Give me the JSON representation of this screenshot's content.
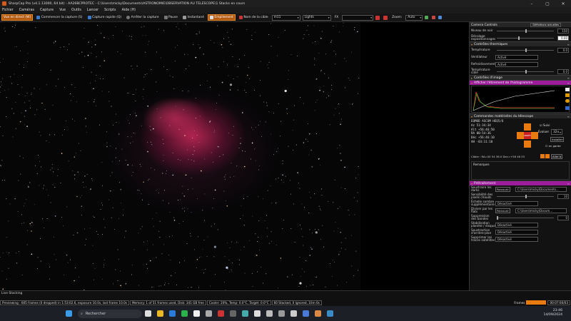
{
  "window": {
    "title": "SharpCap Pro (v4.1.13000, 64 bit) - AA26BCPROTEC - C:\\Users\\micky\\Documents\\ASTRONOMIE\\OBSERVATION AU TELESCOPE\\1 Stacks en cours"
  },
  "menu": [
    "Fichier",
    "Caméras",
    "Capture",
    "Vue",
    "Outils",
    "Lancer",
    "Scripts",
    "Aide (H)"
  ],
  "toolbar": {
    "live_view": "Vue en direct (W)",
    "start_capture": "Commencer la capture (S)",
    "quick_capture": "Capture rapide (Q)",
    "stop_capture": "Arrêter la capture",
    "pause": "Pause",
    "snapshot": "Instantané",
    "stack": "Empilement",
    "target_label": "Nom de la cible",
    "target_value": "m11",
    "frame_type": "Lights",
    "fx_label": "FX",
    "fx_value": "",
    "zoom_label": "Zoom:",
    "zoom_value": "Auto"
  },
  "panel": {
    "camera_controls": "Camera Controls",
    "camera_controls_button": "Définitions actuelles",
    "noise_label": "Niveau de noir",
    "noise_value": "150",
    "sep_label": "Décalage expositionnages",
    "sep_value": "0.00",
    "thermal_title": "Contrôles thermiques",
    "temperature_label": "Température",
    "temperature_value": "0.0",
    "fan_label": "Ventilateur",
    "fan_value": "Activé",
    "cooling_label": "Refroidissement",
    "cooling_value": "Activé",
    "target_temp_label": "Température cible",
    "target_temp_value": "0.0",
    "image_title": "Contrôles d'image",
    "histogram_title": "Afficher l'étirement de l'histogramme",
    "telescope_title": "Commandes matérielles du télescope",
    "mount_name": "EQMOD ASCOM HEQ5/6",
    "tele_lines": [
      "Az     51:34:34",
      "Alt   +56:46:50",
      "RA     00:54:36",
      "Déc   +56:46:10",
      "AH    -03:11:10"
    ],
    "tracking_label": "Suivi",
    "evaluate_label": "Évaluer",
    "speed_value": "32x",
    "install_label": "Installer",
    "park_label": "en garde",
    "goto_label": "ARRÊTEZ",
    "cable_text": "Câble : RA=00 54 36.0 Dec=+56 46 03",
    "goto_button": "Aller à",
    "notes_label": "Remarques",
    "preprocess_title": "Prétraitement",
    "subtract_dark_label": "Soustraire les darks",
    "subtract_dark_button": "Parcourir",
    "subtract_dark_path": "C:\\Users\\micky\\Documents...",
    "hot_pixel_label": "Sensibilité des pixels chauds",
    "hot_pixel_value": "10",
    "bias_label": "Échelle sombre supplémentaire",
    "bias_value": "Désactivé",
    "flat_label": "Diviser par les flats",
    "flat_button": "Parcourir",
    "flat_path": "C:\\Users\\micky\\Docum...",
    "banding_label": "Suppression des bandes",
    "banding_value": "0",
    "planet_label": "Stabilisation planète / disque",
    "planet_value": "Désactivé",
    "background_label": "Soustraction d'arrière-plan",
    "background_value": "Désactivé",
    "satellite_label": "Supprimer les traces satellites",
    "satellite_value": "Désactivé"
  },
  "status": {
    "live_stacking": "Live Stacking",
    "previewing": "Previewing : 605 frames (0 dropped) in 1:53:02.6, exposure 10.0s, last frame 10.0s",
    "memory": "Memory: 1 of 51 frames used, Disk: 341 GB free",
    "cooler": "Cooler: 20%, Temp: 0.0°C, Target: 0.0°C",
    "stacked": "60 Stacked, 0 Ignored, 10m 0s",
    "frames_label": "Frames",
    "time_value": "00:07:00/03"
  },
  "taskbar": {
    "search_placeholder": "Rechercher",
    "time": "23:46",
    "date": "14/09/2024"
  }
}
